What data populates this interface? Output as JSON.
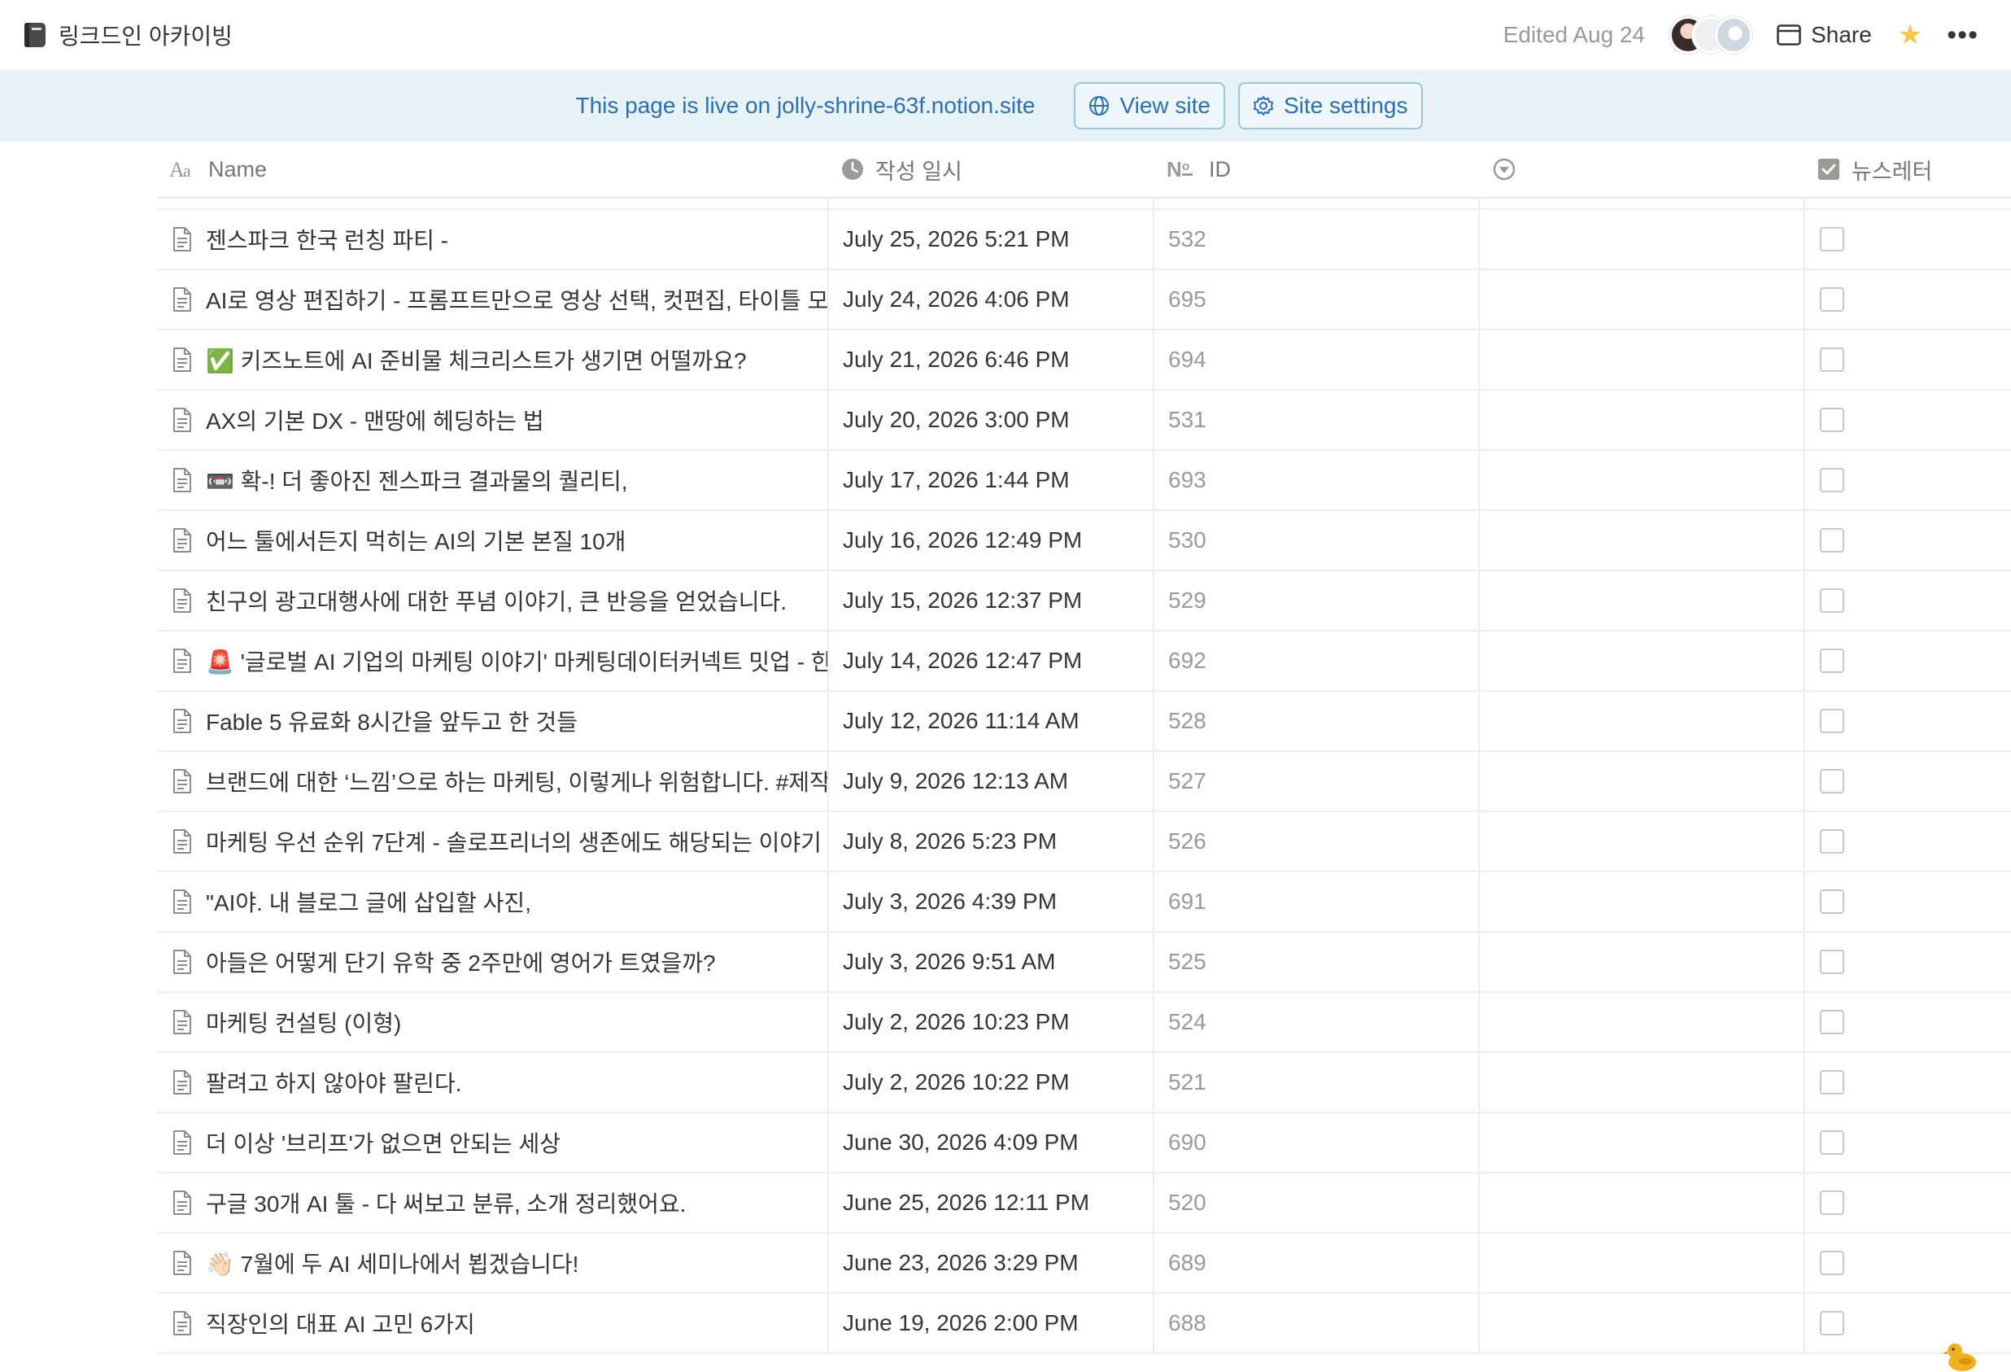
{
  "topbar": {
    "page_title": "링크드인 아카이빙",
    "page_icon": "book-icon",
    "edited": "Edited Aug 24",
    "share_label": "Share"
  },
  "banner": {
    "text": "This page is live on jolly-shrine-63f.notion.site",
    "view_site_label": "View site",
    "site_settings_label": "Site settings",
    "background": "#e7f3f8",
    "accent": "#2f6fb0"
  },
  "table": {
    "columns": [
      {
        "label": "Name",
        "icon": "text-property-icon"
      },
      {
        "label": "작성 일시",
        "icon": "clock-icon"
      },
      {
        "label": "ID",
        "icon": "number-id-icon"
      },
      {
        "label": "",
        "icon": "status-icon"
      },
      {
        "label": "뉴스레터",
        "icon": "checkbox-property-icon"
      }
    ],
    "rows": [
      {
        "title": "젠스파크 한국 런칭 파티 -",
        "date": "July 25, 2026 5:21 PM",
        "id": "532"
      },
      {
        "title": "AI로 영상 편집하기 - 프롬프트만으로 영상 선택, 컷편집, 타이틀 모션 ...",
        "date": "July 24, 2026 4:06 PM",
        "id": "695"
      },
      {
        "title": "✅ 키즈노트에 AI 준비물 체크리스트가 생기면 어떨까요?",
        "date": "July 21, 2026 6:46 PM",
        "id": "694"
      },
      {
        "title": "AX의 기본 DX - 맨땅에 헤딩하는 법",
        "date": "July 20, 2026 3:00 PM",
        "id": "531"
      },
      {
        "title": "📼 확-! 더 좋아진 젠스파크 결과물의 퀄리티,",
        "date": "July 17, 2026 1:44 PM",
        "id": "693"
      },
      {
        "title": "어느 툴에서든지 먹히는 AI의 기본 본질 10개",
        "date": "July 16, 2026 12:49 PM",
        "id": "530"
      },
      {
        "title": "친구의 광고대행사에 대한 푸념 이야기, 큰 반응을 얻었습니다.",
        "date": "July 15, 2026 12:37 PM",
        "id": "529"
      },
      {
        "title": "🚨 '글로벌 AI 기업의 마케팅 이야기' 마케팅데이터커넥트 밋업 - 한국",
        "date": "July 14, 2026 12:47 PM",
        "id": "692"
      },
      {
        "title": "Fable 5 유료화 8시간을 앞두고 한 것들",
        "date": "July 12, 2026 11:14 AM",
        "id": "528"
      },
      {
        "title": "브랜드에 대한 ‘느낌’으로 하는 마케팅, 이렇게나 위험합니다. #제작지원",
        "date": "July 9, 2026 12:13 AM",
        "id": "527"
      },
      {
        "title": "마케팅 우선 순위 7단계 - 솔로프리너의 생존에도 해당되는 이야기",
        "date": "July 8, 2026 5:23 PM",
        "id": "526"
      },
      {
        "title": "\"AI야. 내 블로그 글에 삽입할 사진,",
        "date": "July 3, 2026 4:39 PM",
        "id": "691"
      },
      {
        "title": "아들은 어떻게 단기 유학 중 2주만에 영어가 트였을까?",
        "date": "July 3, 2026 9:51 AM",
        "id": "525"
      },
      {
        "title": "마케팅 컨설팅 (이형)",
        "date": "July 2, 2026 10:23 PM",
        "id": "524"
      },
      {
        "title": "팔려고 하지 않아야 팔린다.",
        "date": "July 2, 2026 10:22 PM",
        "id": "521"
      },
      {
        "title": "더 이상 '브리프'가 없으면 안되는 세상",
        "date": "June 30, 2026 4:09 PM",
        "id": "690"
      },
      {
        "title": "구글 30개 AI 툴 - 다 써보고 분류, 소개 정리했어요.",
        "date": "June 25, 2026 12:11 PM",
        "id": "520"
      },
      {
        "title": "👋🏻 7월에 두 AI 세미나에서 뵙겠습니다!",
        "date": "June 23, 2026 3:29 PM",
        "id": "689"
      },
      {
        "title": "직장인의 대표 AI 고민 6가지",
        "date": "June 19, 2026 2:00 PM",
        "id": "688"
      }
    ]
  }
}
